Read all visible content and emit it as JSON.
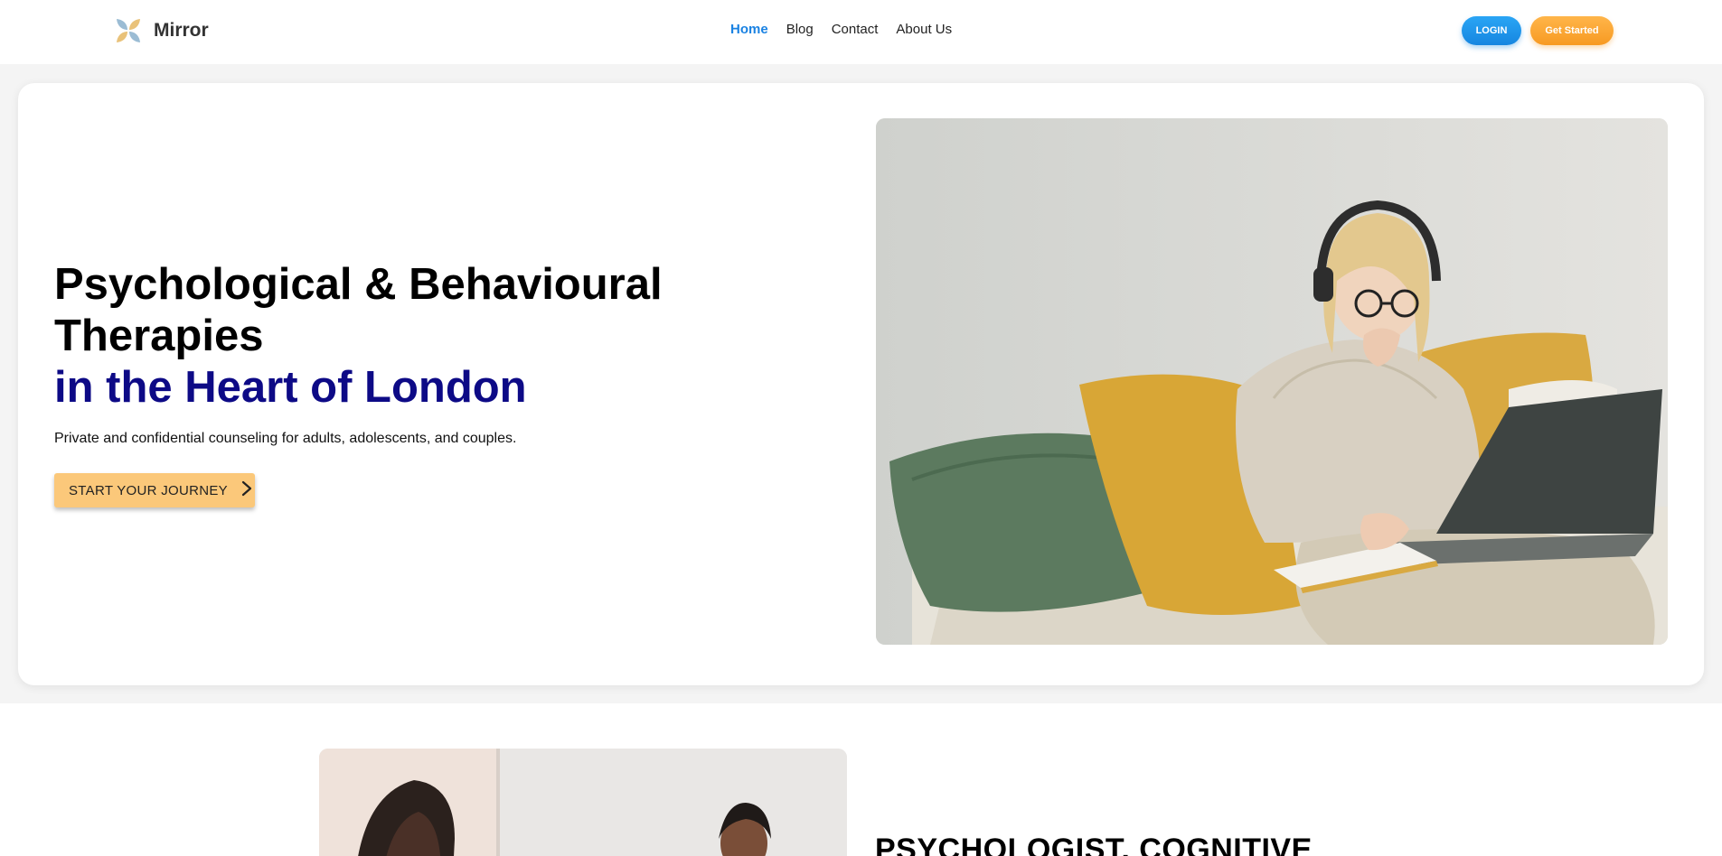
{
  "header": {
    "brand": "Mirror",
    "nav": [
      {
        "label": "Home",
        "active": true
      },
      {
        "label": "Blog",
        "active": false
      },
      {
        "label": "Contact",
        "active": false
      },
      {
        "label": "About Us",
        "active": false
      }
    ],
    "login_label": "LOGIN",
    "get_started_label": "Get Started"
  },
  "hero": {
    "title_line1": "Psychological & Behavioural",
    "title_line2": "Therapies",
    "title_line3": "in the Heart of London",
    "subtitle": "Private and confidential counseling for adults, adolescents, and couples.",
    "cta_label": "START YOUR JOURNEY"
  },
  "section2": {
    "title": "PSYCHOLOGIST, COGNITIVE"
  },
  "colors": {
    "accent_blue": "#1a82e2",
    "accent_orange": "#f79a22",
    "title_navy": "#0d0a86",
    "cta_bg": "#fbc87a"
  }
}
